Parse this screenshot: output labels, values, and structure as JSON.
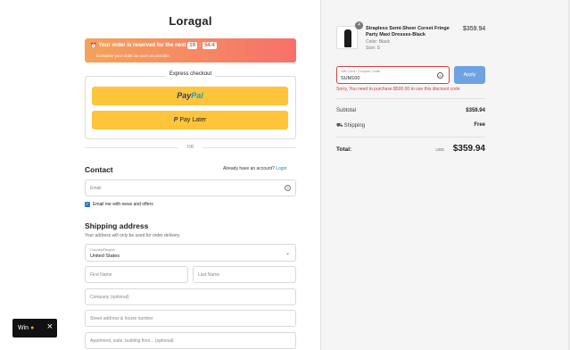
{
  "store": {
    "name": "Loragal"
  },
  "timer": {
    "text": "Your order is reserved for the next",
    "minutes": "19",
    "seconds": "54.4",
    "subtext": "Complete your order as soon as possible."
  },
  "express": {
    "title": "Express checkout",
    "paypal_pay": "Pay",
    "paypal_pal": "Pal",
    "paylater_label": "Pay Later",
    "or": "OR"
  },
  "contact": {
    "heading": "Contact",
    "account_prompt": "Already have an account?",
    "login_link": "Login",
    "email_placeholder": "Email",
    "news_checkbox": "Email me with news and offers"
  },
  "shipping": {
    "heading": "Shipping address",
    "subtext": "Your address will only be used for order delivery.",
    "country_label": "Country/Region",
    "country_value": "United States",
    "first_name": "First Name",
    "last_name": "Last Name",
    "company": "Company (optional)",
    "street": "Street address & house number",
    "apartment": "Apartment, suite, building floor... (optional)"
  },
  "popup": {
    "label": "Win"
  },
  "summary": {
    "item": {
      "quantity": "4",
      "name": "Strapless Semi-Sheer Corset Fringe Party Maxi Dresses-Black",
      "color": "Color: Black",
      "size": "Size: S",
      "price": "$359.94"
    },
    "coupon": {
      "label": "Gift Card / Coupon Code",
      "value": "SUM100",
      "apply": "Apply",
      "error": "Sorry, You need to purchase $500.00 to use this discount code"
    },
    "subtotal_label": "Subtotal",
    "subtotal_value": "$359.94",
    "shipping_label": "Shipping",
    "shipping_value": "Free",
    "total_label": "Total:",
    "currency": "USD",
    "total_value": "$359.94"
  },
  "colors": {
    "accent": "#2a7cc7",
    "paypal_yellow": "#ffc439",
    "error": "#d93a3a",
    "apply_button": "#6fa2e0"
  }
}
